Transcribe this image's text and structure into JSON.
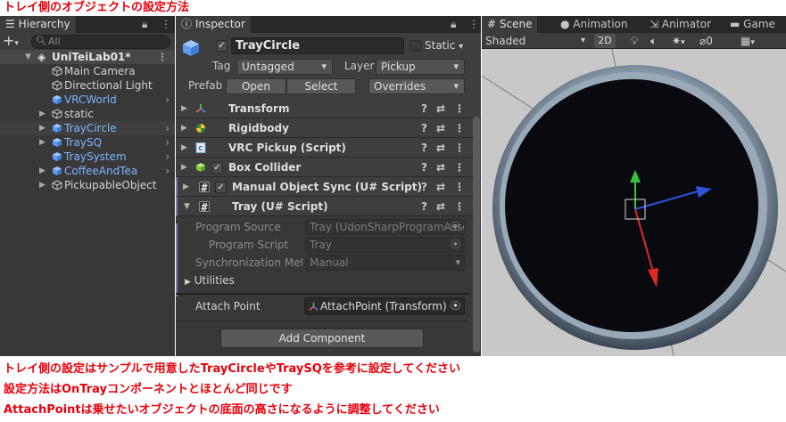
{
  "page": {
    "title": "トレイ側のオブジェクトの設定方法",
    "notes": [
      "トレイ側の設定はサンプルで用意したTrayCircleやTraySQを参考に設定してください",
      "設定方法はOnTrayコンポーネントとほとんど同じです",
      "AttachPointは乗せたいオブジェクトの底面の高さになるように調整してください"
    ]
  },
  "hierarchy": {
    "tab_label": "Hierarchy",
    "add_label": "+",
    "search_placeholder": "All",
    "scene_name": "UniTeiLab01*",
    "items": [
      {
        "label": "Main Camera",
        "icon": "gameobject-icon",
        "prefab": false
      },
      {
        "label": "Directional Light",
        "icon": "gameobject-icon",
        "prefab": false
      },
      {
        "label": "VRCWorld",
        "icon": "prefab-icon",
        "prefab": true
      },
      {
        "label": "static",
        "icon": "gameobject-icon",
        "prefab": false
      },
      {
        "label": "TrayCircle",
        "icon": "prefab-icon",
        "prefab": true,
        "selected": true
      },
      {
        "label": "TraySQ",
        "icon": "prefab-icon",
        "prefab": true
      },
      {
        "label": "TraySystem",
        "icon": "prefab-icon",
        "prefab": true
      },
      {
        "label": "CoffeeAndTea",
        "icon": "prefab-icon",
        "prefab": true
      },
      {
        "label": "PickupableObject",
        "icon": "gameobject-icon",
        "prefab": false
      }
    ]
  },
  "inspector": {
    "tab_label": "Inspector",
    "object_name": "TrayCircle",
    "static_label": "Static",
    "tag_label": "Tag",
    "tag_value": "Untagged",
    "layer_label": "Layer",
    "layer_value": "Pickup",
    "prefab_label": "Prefab",
    "open_label": "Open",
    "select_label": "Select",
    "overrides_label": "Overrides",
    "components": [
      {
        "name": "Transform",
        "icon": "transform-icon"
      },
      {
        "name": "Rigidbody",
        "icon": "rigidbody-icon"
      },
      {
        "name": "VRC Pickup (Script)",
        "icon": "script-icon"
      },
      {
        "name": "Box Collider",
        "icon": "box-collider-icon",
        "checkbox": true
      },
      {
        "name": "Manual Object Sync (U# Script)",
        "icon": "udon-script-icon",
        "checkbox": true
      },
      {
        "name": "Tray (U# Script)",
        "icon": "udon-script-icon",
        "expanded": true
      }
    ],
    "tray": {
      "program_source_label": "Program Source",
      "program_source_value": "Tray (UdonSharpProgramAsset)",
      "program_script_label": "Program Script",
      "program_script_value": "Tray",
      "sync_label": "Synchronization Method",
      "sync_value": "Manual",
      "utilities_label": "Utilities",
      "attach_label": "Attach Point",
      "attach_value": "AttachPoint (Transform)"
    },
    "add_component_label": "Add Component"
  },
  "scene": {
    "tabs": [
      "Scene",
      "Animation",
      "Animator",
      "Game"
    ],
    "shading": "Shaded",
    "mode_2d": "2D",
    "gizmo_count": "0"
  },
  "colors": {
    "annotation_red": "#e8000b",
    "prefab_blue": "#7fb3ff",
    "editor_bg": "#383838"
  }
}
